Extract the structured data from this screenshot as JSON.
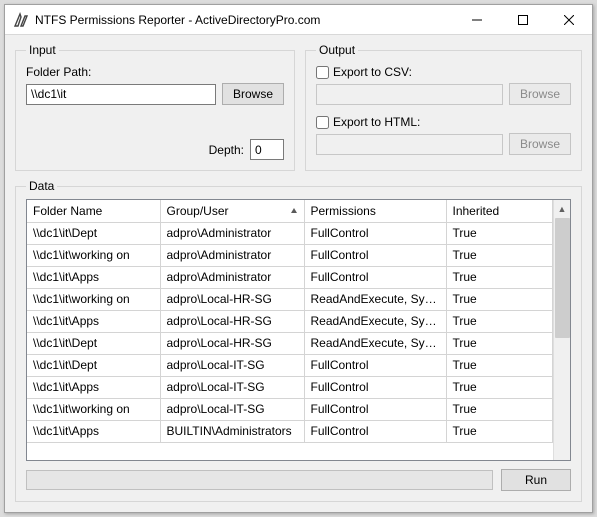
{
  "window": {
    "title": "NTFS Permissions Reporter - ActiveDirectoryPro.com"
  },
  "input": {
    "legend": "Input",
    "folder_label": "Folder Path:",
    "folder_value": "\\\\dc1\\it",
    "browse_label": "Browse",
    "depth_label": "Depth:",
    "depth_value": "0"
  },
  "output": {
    "legend": "Output",
    "csv_label": "Export to CSV:",
    "csv_path": "",
    "csv_browse_label": "Browse",
    "html_label": "Export to HTML:",
    "html_path": "",
    "html_browse_label": "Browse"
  },
  "data": {
    "legend": "Data",
    "cols": {
      "folder": "Folder Name",
      "user": "Group/User",
      "perm": "Permissions",
      "inherit": "Inherited"
    },
    "rows": [
      {
        "folder": "\\\\dc1\\it\\Dept",
        "user": "adpro\\Administrator",
        "perm": "FullControl",
        "inherit": "True"
      },
      {
        "folder": "\\\\dc1\\it\\working on",
        "user": "adpro\\Administrator",
        "perm": "FullControl",
        "inherit": "True"
      },
      {
        "folder": "\\\\dc1\\it\\Apps",
        "user": "adpro\\Administrator",
        "perm": "FullControl",
        "inherit": "True"
      },
      {
        "folder": "\\\\dc1\\it\\working on",
        "user": "adpro\\Local-HR-SG",
        "perm": "ReadAndExecute, Syn...",
        "inherit": "True"
      },
      {
        "folder": "\\\\dc1\\it\\Apps",
        "user": "adpro\\Local-HR-SG",
        "perm": "ReadAndExecute, Syn...",
        "inherit": "True"
      },
      {
        "folder": "\\\\dc1\\it\\Dept",
        "user": "adpro\\Local-HR-SG",
        "perm": "ReadAndExecute, Syn...",
        "inherit": "True"
      },
      {
        "folder": "\\\\dc1\\it\\Dept",
        "user": "adpro\\Local-IT-SG",
        "perm": "FullControl",
        "inherit": "True"
      },
      {
        "folder": "\\\\dc1\\it\\Apps",
        "user": "adpro\\Local-IT-SG",
        "perm": "FullControl",
        "inherit": "True"
      },
      {
        "folder": "\\\\dc1\\it\\working on",
        "user": "adpro\\Local-IT-SG",
        "perm": "FullControl",
        "inherit": "True"
      },
      {
        "folder": "\\\\dc1\\it\\Apps",
        "user": "BUILTIN\\Administrators",
        "perm": "FullControl",
        "inherit": "True"
      }
    ]
  },
  "footer": {
    "run_label": "Run"
  }
}
